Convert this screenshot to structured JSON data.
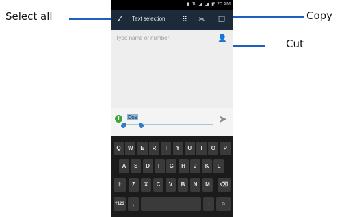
{
  "callouts": {
    "select_all": "Select all",
    "copy": "Copy",
    "cut": "Cut"
  },
  "statusbar": {
    "icons": "▮ ⇅ ◢ ◢ ▮",
    "time": "8:20 AM"
  },
  "actionbar": {
    "check_icon": "✓",
    "title": "Text selection",
    "select_all_icon": "⠿",
    "cut_icon": "✂",
    "copy_icon": "❐"
  },
  "recipient": {
    "placeholder": "Type name or number",
    "contact_icon": "👤"
  },
  "compose": {
    "add_icon": "+",
    "text": "Dss",
    "send_icon": "➤"
  },
  "keyboard": {
    "row1": [
      "Q",
      "W",
      "E",
      "R",
      "T",
      "Y",
      "U",
      "I",
      "O",
      "P"
    ],
    "row2": [
      "A",
      "S",
      "D",
      "F",
      "G",
      "H",
      "J",
      "K",
      "L"
    ],
    "row3_shift": "⇧",
    "row3": [
      "Z",
      "X",
      "C",
      "V",
      "B",
      "N",
      "M"
    ],
    "row3_delete": "⌫",
    "row4_symbols": "?123",
    "row4_comma": ",",
    "row4_period": ".",
    "row4_emoji": "☺"
  },
  "colors": {
    "actionbar": "#1c2a3a",
    "callout_line": "#1f5fbf",
    "accent": "#2e7cc2"
  }
}
